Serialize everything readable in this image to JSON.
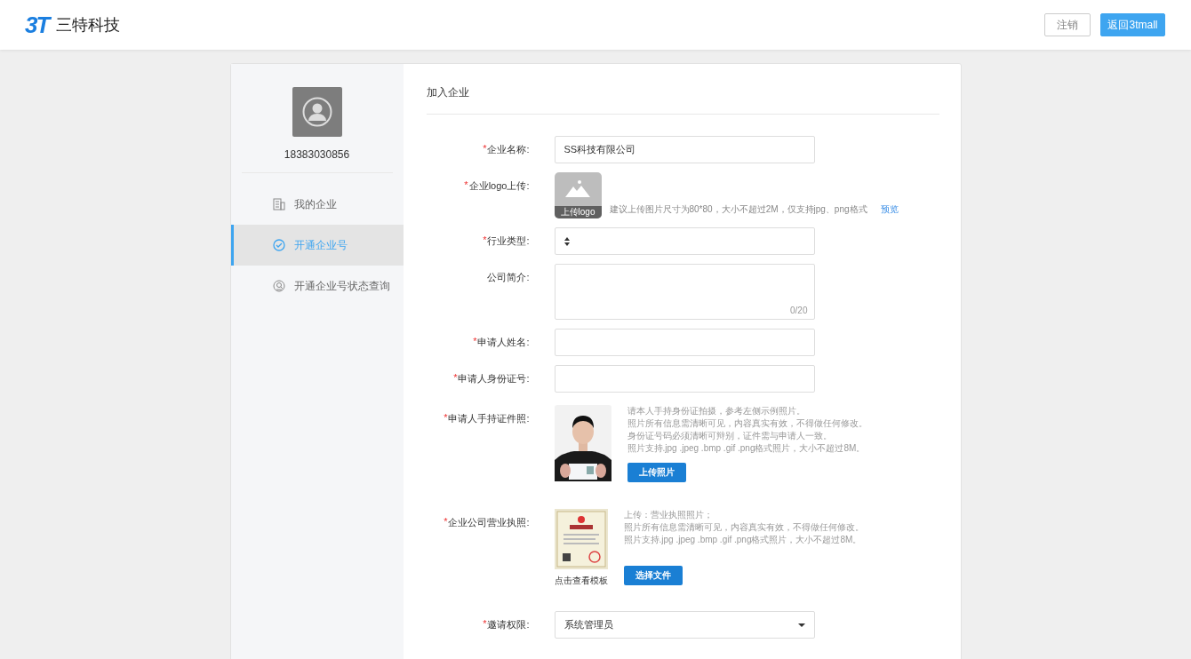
{
  "header": {
    "logo_text": "3T",
    "brand": "三特科技",
    "buttons": [
      {
        "label": "注销",
        "kind": "outline"
      },
      {
        "label": "返回3tmall",
        "kind": "primary"
      }
    ]
  },
  "sidebar": {
    "phone": "18383030856",
    "items": [
      {
        "label": "我的企业",
        "kind": "building",
        "selected": false
      },
      {
        "label": "开通企业号",
        "kind": "check",
        "selected": true
      },
      {
        "label": "开通企业号状态查询",
        "kind": "search",
        "selected": false
      }
    ]
  },
  "form": {
    "title": "加入企业",
    "fields": [
      {
        "kind": "text",
        "required_mark": "*",
        "label": "企业名称:",
        "value": "SS科技有限公司"
      },
      {
        "kind": "logo",
        "required_mark": "*",
        "label": "企业logo上传:",
        "upload_label": "上传logo",
        "hint": "建议上传图片尺寸为80*80，大小不超过2M，仅支持jpg、png格式",
        "link": "预览"
      },
      {
        "kind": "select",
        "required_mark": "*",
        "label": "行业类型:"
      },
      {
        "kind": "textarea",
        "label": "公司简介:",
        "counter": "0/20"
      },
      {
        "kind": "text",
        "required_mark": "*",
        "label": "申请人姓名:"
      },
      {
        "kind": "text",
        "required_mark": "*",
        "label": "申请人身份证号:"
      },
      {
        "required_mark": "*",
        "label": "申请人手持证件照:",
        "notes": [
          "请本人手持身份证拍摄，参考左侧示例照片。",
          "照片所有信息需清晰可见，内容真实有效，不得做任何修改。",
          "身份证号码必须清晰可辩别，证件需与申请人一致。",
          "照片支持.jpg .jpeg .bmp .gif .png格式照片，大小不超过8M。"
        ],
        "button": "上传照片"
      },
      {
        "kind": "license",
        "required_mark": "*",
        "label": "企业公司营业执照:",
        "caption": "点击查看模板",
        "notes": [
          "上传：营业执照照片；",
          "照片所有信息需清晰可见，内容真实有效，不得做任何修改。",
          "照片支持.jpg .jpeg .bmp .gif .png格式照片，大小不超过8M。"
        ],
        "button": "选择文件"
      },
      {
        "kind": "dropdown",
        "required_mark": "*",
        "label": "邀请权限:",
        "value": "系统管理员"
      }
    ]
  }
}
